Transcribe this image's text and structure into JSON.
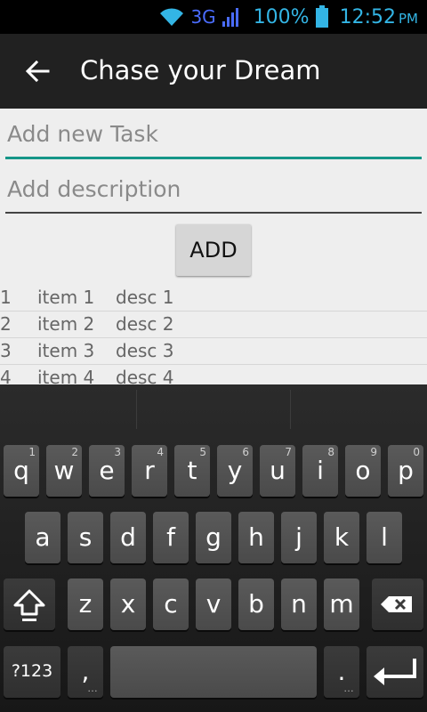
{
  "status": {
    "network": "3G",
    "battery": "100%",
    "time": "12:52",
    "ampm": "PM",
    "icons": [
      "wifi-icon",
      "signal-icon",
      "battery-icon"
    ]
  },
  "actionbar": {
    "title": "Chase your Dream",
    "back_icon": "arrow-back-icon"
  },
  "form": {
    "task_placeholder": "Add new Task",
    "desc_placeholder": "Add description",
    "add_label": "ADD"
  },
  "tasks": [
    {
      "id": "1",
      "name": "item 1",
      "desc": "desc 1"
    },
    {
      "id": "2",
      "name": "item 2",
      "desc": "desc 2"
    },
    {
      "id": "3",
      "name": "item 3",
      "desc": "desc 3"
    },
    {
      "id": "4",
      "name": "item 4",
      "desc": "desc 4"
    }
  ],
  "keyboard": {
    "row1": [
      {
        "k": "q",
        "h": "1"
      },
      {
        "k": "w",
        "h": "2"
      },
      {
        "k": "e",
        "h": "3"
      },
      {
        "k": "r",
        "h": "4"
      },
      {
        "k": "t",
        "h": "5"
      },
      {
        "k": "y",
        "h": "6"
      },
      {
        "k": "u",
        "h": "7"
      },
      {
        "k": "i",
        "h": "8"
      },
      {
        "k": "o",
        "h": "9"
      },
      {
        "k": "p",
        "h": "0"
      }
    ],
    "row2": [
      "a",
      "s",
      "d",
      "f",
      "g",
      "h",
      "j",
      "k",
      "l"
    ],
    "row3": [
      "z",
      "x",
      "c",
      "v",
      "b",
      "n",
      "m"
    ],
    "symbols": "?123",
    "comma": ",",
    "period": ".",
    "colors": {
      "accent": "#159688",
      "status": "#33b5e5"
    }
  }
}
